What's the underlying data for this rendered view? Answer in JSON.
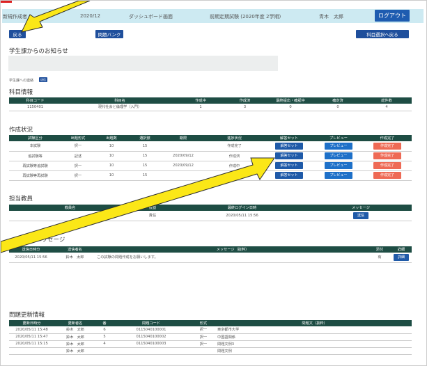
{
  "header": {
    "user_text": "新規作成者",
    "date_text": "2020/12",
    "dashboard_text": "ダッシュボード画面",
    "exam_text": "前期定期試験 (2020年度 2学期)",
    "name_text": "青木　太郎",
    "logout_label": "ログアウト"
  },
  "toolbar": {
    "back_label": "戻る",
    "question_bank_label": "問題バンク",
    "subject_select_label": "科目選択へ戻る"
  },
  "notice": {
    "title": "学生課からのお知らせ",
    "sub_label": "学生課への連絡",
    "sub_button": "送信"
  },
  "subject": {
    "title": "科目情報",
    "columns": [
      "科目コード",
      "科目名",
      "作成中",
      "作成済",
      "最終提出・確認中",
      "確定済",
      "総件数"
    ],
    "rows": [
      [
        "1150401",
        "現代社会と倫理学（入門）",
        "1",
        "3",
        "0",
        "0",
        "4"
      ]
    ]
  },
  "status": {
    "title": "作成状況",
    "columns": [
      "試験区分",
      "出題形式",
      "出題数",
      "選択肢",
      "期限",
      "進捗状況",
      "解答セット",
      "プレビュー",
      "作成完了"
    ],
    "rows": [
      {
        "cells": [
          "本試験",
          "択一",
          "10",
          "15",
          "",
          "作成完了"
        ],
        "set": "解答セット",
        "preview": "プレビュー",
        "done": "作成完了"
      },
      {
        "cells": [
          "追試験等",
          "記述",
          "10",
          "15",
          "2020/09/12",
          "作成済"
        ],
        "set": "解答セット",
        "preview": "プレビュー",
        "done": "作成完了"
      },
      {
        "cells": [
          "再試験等追試験",
          "択一",
          "10",
          "15",
          "2020/09/12",
          "作成中"
        ],
        "set": "解答セット",
        "preview": "プレビュー",
        "done": "作成完了"
      },
      {
        "cells": [
          "再試験等再試験",
          "択一",
          "10",
          "15",
          "",
          "作成中"
        ],
        "set": "解答セット",
        "preview": "プレビュー",
        "done": "作成完了"
      }
    ]
  },
  "staff": {
    "title": "担当教員",
    "columns": [
      "教員名",
      "役割",
      "最終ログイン日時",
      "メッセージ"
    ],
    "rows": [
      {
        "cells": [
          "",
          "責任",
          "2020/05/11 15:56"
        ],
        "button": "送信"
      }
    ]
  },
  "messages": {
    "title": "メッセージ",
    "columns": [
      "送信日時分",
      "送信者名",
      "メッセージ（抜粋）",
      "添付",
      "詳細"
    ],
    "rows": [
      {
        "cells": [
          "2020/05/11 15:56",
          "鈴木　太郎",
          "この試験の問題作成をお願いします。",
          "有"
        ],
        "button": "詳細"
      }
    ]
  },
  "updates": {
    "title": "問題更新情報",
    "columns": [
      "更新日時分",
      "更新者名",
      "番",
      "問題コード",
      "形式",
      "問題文（抜粋）"
    ],
    "rows": [
      [
        "2020/05/11 15:48",
        "鈴木　太郎",
        "6",
        "0115040100001",
        "択一",
        "東京都市大学"
      ],
      [
        "2020/05/11 15:47",
        "鈴木　太郎",
        "5",
        "0115040100002",
        "択一",
        "中国語関係"
      ],
      [
        "2020/05/11 15:15",
        "鈴木　太郎",
        "4",
        "0115040100003",
        "択一",
        "問題文例3"
      ],
      [
        "",
        "鈴木　太郎",
        "",
        "",
        "",
        "問題文例"
      ]
    ]
  }
}
